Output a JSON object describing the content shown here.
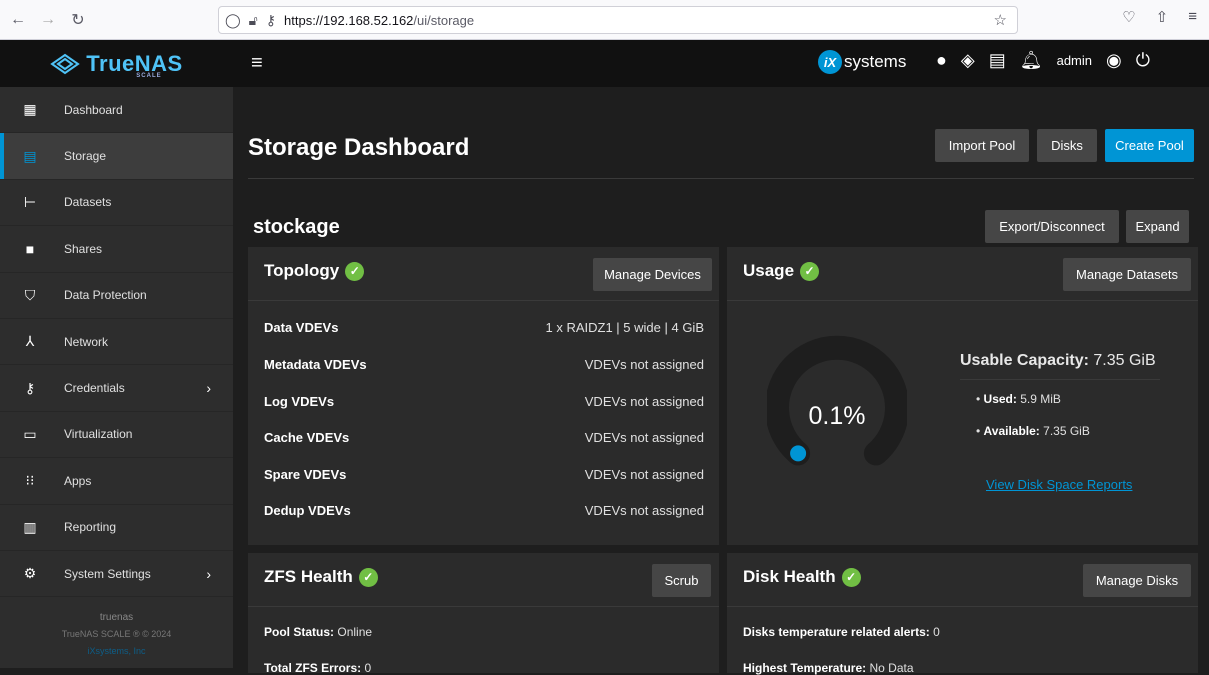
{
  "browser": {
    "url_host": "https://192.168.52.162",
    "url_path": "/ui/storage"
  },
  "header": {
    "logo_text": "TrueNAS",
    "logo_sub": "SCALE",
    "ix_text": "systems",
    "ix_mark": "iX",
    "user": "admin"
  },
  "sidebar": {
    "items": [
      {
        "label": "Dashboard",
        "icon": "dashboard-icon"
      },
      {
        "label": "Storage",
        "icon": "storage-icon"
      },
      {
        "label": "Datasets",
        "icon": "datasets-icon"
      },
      {
        "label": "Shares",
        "icon": "shares-icon"
      },
      {
        "label": "Data Protection",
        "icon": "shield-icon"
      },
      {
        "label": "Network",
        "icon": "network-icon"
      },
      {
        "label": "Credentials",
        "icon": "key-icon"
      },
      {
        "label": "Virtualization",
        "icon": "laptop-icon"
      },
      {
        "label": "Apps",
        "icon": "apps-icon"
      },
      {
        "label": "Reporting",
        "icon": "reporting-icon"
      },
      {
        "label": "System Settings",
        "icon": "gear-icon"
      }
    ],
    "footer_host": "truenas",
    "footer_copy": "TrueNAS SCALE ® © 2024",
    "footer_company": "iXsystems, Inc"
  },
  "main": {
    "title": "Storage Dashboard",
    "import_pool": "Import Pool",
    "disks": "Disks",
    "create_pool": "Create Pool",
    "pool_name": "stockage",
    "export_disconnect": "Export/Disconnect",
    "expand": "Expand"
  },
  "topology": {
    "title": "Topology",
    "button": "Manage Devices",
    "rows": [
      {
        "label": "Data VDEVs",
        "value": "1 x RAIDZ1 | 5 wide | 4 GiB"
      },
      {
        "label": "Metadata VDEVs",
        "value": "VDEVs not assigned"
      },
      {
        "label": "Log VDEVs",
        "value": "VDEVs not assigned"
      },
      {
        "label": "Cache VDEVs",
        "value": "VDEVs not assigned"
      },
      {
        "label": "Spare VDEVs",
        "value": "VDEVs not assigned"
      },
      {
        "label": "Dedup VDEVs",
        "value": "VDEVs not assigned"
      }
    ]
  },
  "usage": {
    "title": "Usage",
    "button": "Manage Datasets",
    "gauge_percent_text": "0.1%",
    "gauge_fraction": 0.001,
    "usable_label": "Usable Capacity:",
    "usable_value": "7.35 GiB",
    "used_label": "Used:",
    "used_value": "5.9 MiB",
    "available_label": "Available:",
    "available_value": "7.35 GiB",
    "link": "View Disk Space Reports"
  },
  "zfs_health": {
    "title": "ZFS Health",
    "button": "Scrub",
    "pool_status_label": "Pool Status:",
    "pool_status_value": "Online",
    "errors_label": "Total ZFS Errors:",
    "errors_value": "0"
  },
  "disk_health": {
    "title": "Disk Health",
    "button": "Manage Disks",
    "temp_alerts_label": "Disks temperature related alerts:",
    "temp_alerts_value": "0",
    "highest_temp_label": "Highest Temperature:",
    "highest_temp_value": "No Data"
  },
  "colors": {
    "accent": "#0095d5",
    "ok": "#71bf44"
  }
}
